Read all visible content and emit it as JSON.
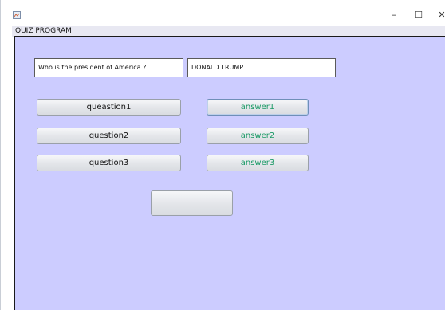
{
  "window": {
    "title": "QUIZ PROGRAM",
    "controls": {
      "minimize_glyph": "–",
      "maximize_glyph": "☐",
      "close_glyph": "✕"
    }
  },
  "quiz": {
    "question_text": "Who is the president of America ?",
    "answer_text": "DONALD TRUMP",
    "question_buttons": [
      "queastion1",
      "question2",
      "question3"
    ],
    "answer_buttons": [
      "answer1",
      "answer2",
      "answer3"
    ],
    "blank_button_label": ""
  },
  "colors": {
    "panel_background": "#ccccff",
    "answer_text_color": "#1b9a66"
  }
}
